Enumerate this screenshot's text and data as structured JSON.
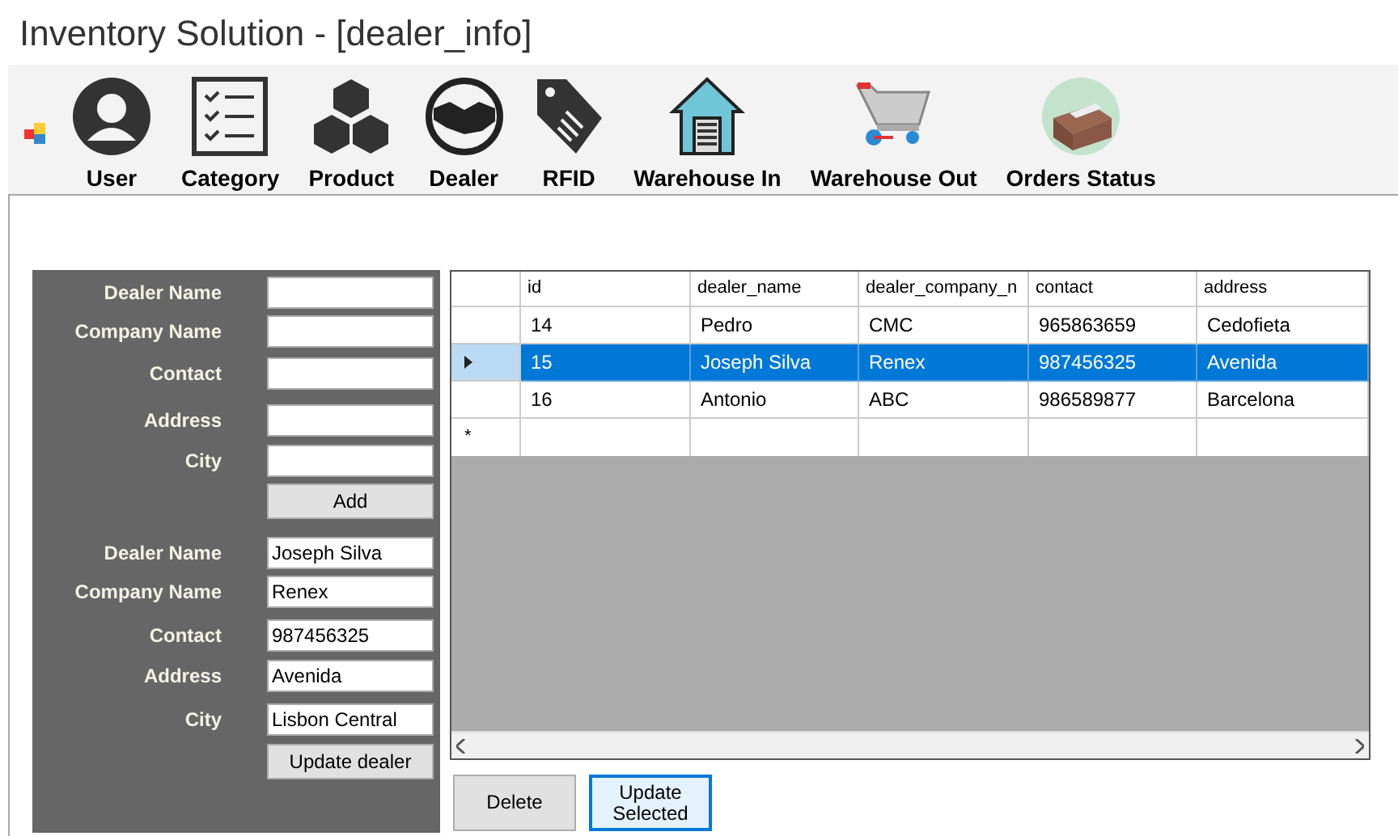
{
  "window": {
    "title": "Inventory Solution - [dealer_info]"
  },
  "toolbar": {
    "items": [
      {
        "label": "User"
      },
      {
        "label": "Category"
      },
      {
        "label": "Product"
      },
      {
        "label": "Dealer"
      },
      {
        "label": "RFID"
      },
      {
        "label": "Warehouse In"
      },
      {
        "label": "Warehouse Out"
      },
      {
        "label": "Orders Status"
      }
    ]
  },
  "add_form": {
    "fields": [
      {
        "label": "Dealer Name"
      },
      {
        "label": "Company Name"
      },
      {
        "label": "Contact"
      },
      {
        "label": "Address"
      },
      {
        "label": "City"
      }
    ],
    "button": "Add"
  },
  "update_form": {
    "fields": [
      {
        "label": "Dealer Name",
        "value": "Joseph Silva"
      },
      {
        "label": "Company Name",
        "value": "Renex"
      },
      {
        "label": "Contact",
        "value": "987456325"
      },
      {
        "label": "Address",
        "value": "Avenida"
      },
      {
        "label": "City",
        "value": "Lisbon Central"
      }
    ],
    "button": "Update dealer"
  },
  "grid": {
    "columns": [
      "id",
      "dealer_name",
      "dealer_company_n",
      "contact",
      "address"
    ],
    "rows": [
      {
        "cells": [
          "14",
          "Pedro",
          "CMC",
          "965863659",
          "Cedofieta"
        ],
        "selected": false
      },
      {
        "cells": [
          "15",
          "Joseph Silva",
          "Renex",
          "987456325",
          "Avenida"
        ],
        "selected": true
      },
      {
        "cells": [
          "16",
          "Antonio",
          "ABC",
          "986589877",
          "Barcelona"
        ],
        "selected": false
      }
    ],
    "new_row_marker": "*"
  },
  "buttons": [
    {
      "label": "Delete",
      "focused": false
    },
    {
      "label": "Update Selected",
      "focused": true
    }
  ]
}
